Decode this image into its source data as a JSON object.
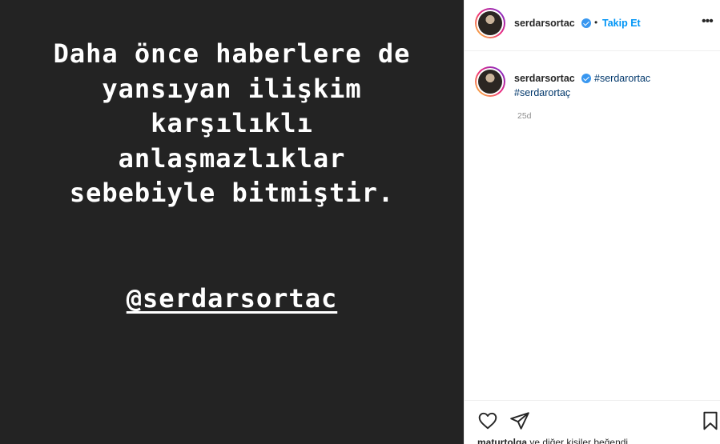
{
  "story": {
    "lines": [
      "Daha önce haberlere de",
      "yansıyan ilişkim",
      "karşılıklı",
      "anlaşmazlıklar",
      "sebebiyle bitmiştir."
    ],
    "mention": "@serdarsortac"
  },
  "header": {
    "username": "serdarsortac",
    "separator": "•",
    "follow_label": "Takip Et",
    "more_label": "•••"
  },
  "caption": {
    "username": "serdarsortac",
    "hashtags": [
      "#serdarortac",
      "#serdarortaç"
    ],
    "timestamp": "25d"
  },
  "footer": {
    "liker": "maturtolga",
    "likes_suffix": " ve diğer kişiler beğendi"
  },
  "colors": {
    "story_bg": "#232323",
    "link_blue": "#0095f6",
    "hashtag": "#00376b",
    "verified": "#3897f0"
  },
  "icons": [
    "heart-icon",
    "share-icon",
    "bookmark-icon",
    "more-icon",
    "verified-badge-icon"
  ]
}
